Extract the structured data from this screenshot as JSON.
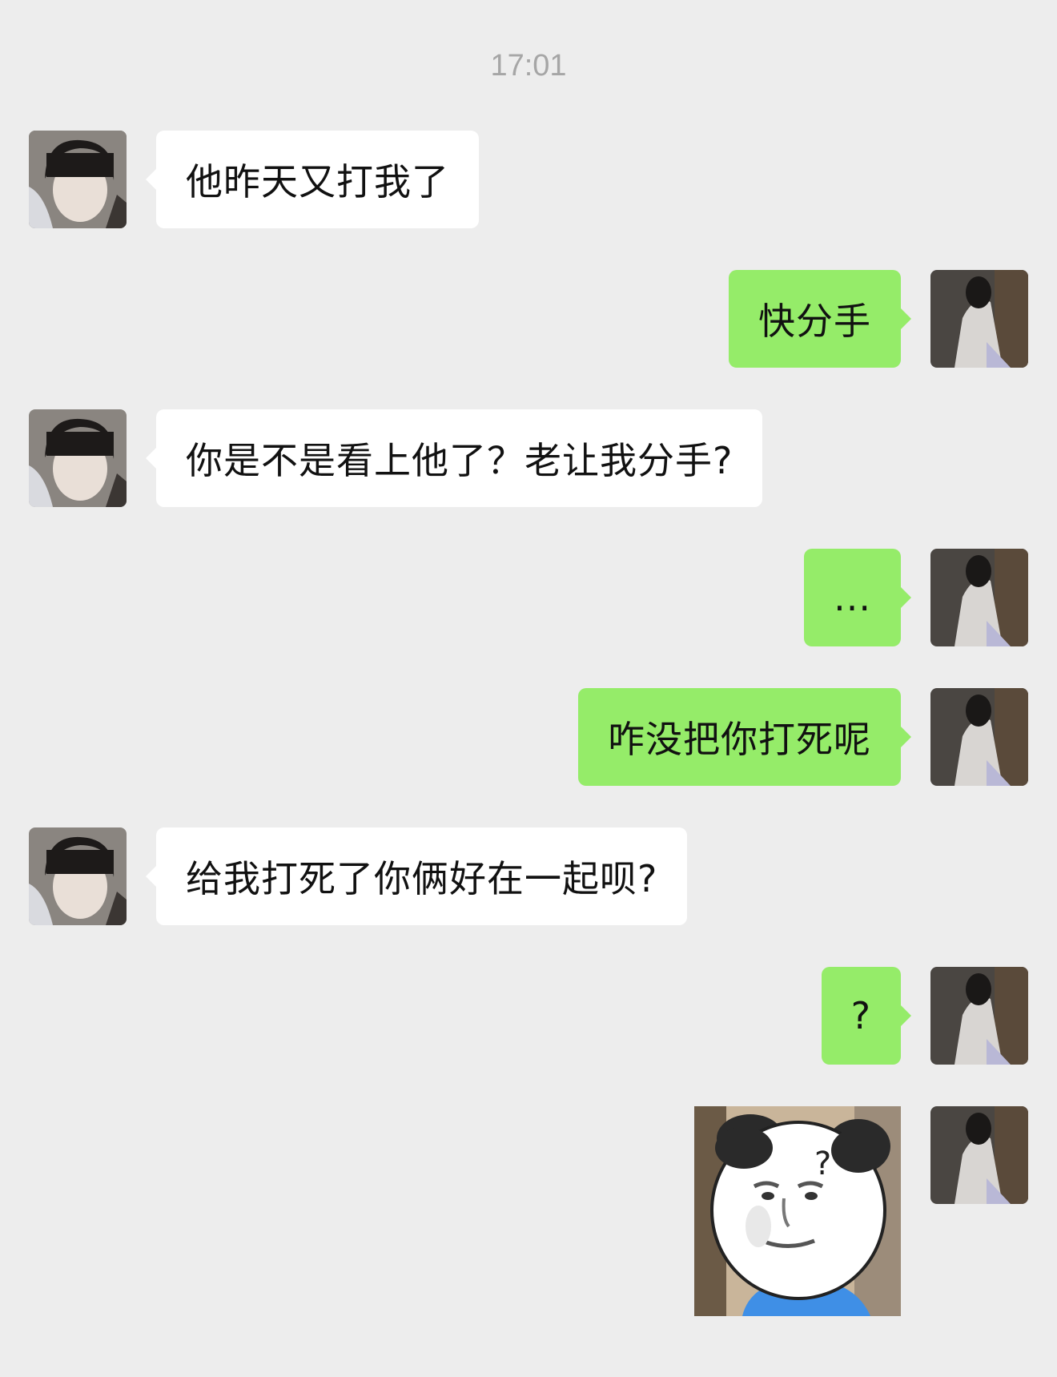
{
  "chat": {
    "timestamp": "17:01",
    "messages": [
      {
        "side": "left",
        "text": "他昨天又打我了"
      },
      {
        "side": "right",
        "text": "快分手"
      },
      {
        "side": "left",
        "text": "你是不是看上他了？老让我分手?"
      },
      {
        "side": "right",
        "text": "..."
      },
      {
        "side": "right",
        "text": "咋没把你打死呢"
      },
      {
        "side": "left",
        "text": "给我打死了你俩好在一起呗?"
      },
      {
        "side": "right",
        "text": "?"
      }
    ],
    "sticker": {
      "icon": "panda-meme-question-sticker",
      "mark": "?"
    }
  },
  "colors": {
    "background": "#ededed",
    "incoming_bubble": "#ffffff",
    "outgoing_bubble": "#95ec69",
    "timestamp_text": "#a6a6a6"
  }
}
